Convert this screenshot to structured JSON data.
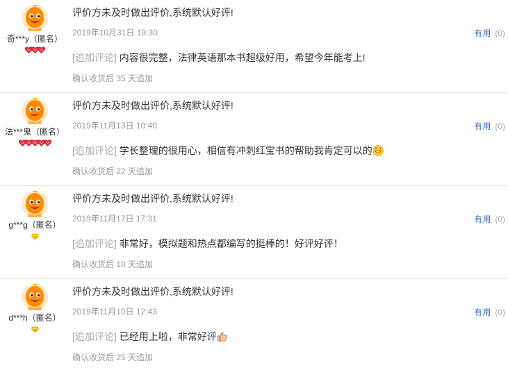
{
  "reviews": [
    {
      "user": "奇***y（匿名）",
      "level_icon": "red-heart-diamond-icon",
      "level_count": 3,
      "content": "评价方未及时做出评价,系统默认好评!",
      "date": "2019年10月31日 19:30",
      "useful_label": "有用",
      "useful_count": "(0)",
      "add_label": "[追加评论]",
      "add_text": "内容很完整，法律英语那本书超级好用，希望今年能考上!",
      "add_emoji": "",
      "confirm": "确认收货后 35 天追加"
    },
    {
      "user": "法***鬼（匿名）",
      "level_icon": "red-heart-diamond-icon",
      "level_count": 5,
      "content": "评价方未及时做出评价,系统默认好评!",
      "date": "2019年11月13日 10:40",
      "useful_label": "有用",
      "useful_count": "(0)",
      "add_label": "[追加评论]",
      "add_text": "学长整理的很用心，相信有冲刺红宝书的帮助我肯定可以的",
      "add_emoji": "grinning-emoji-icon",
      "confirm": "确认收货后 22 天追加"
    },
    {
      "user": "g***g（匿名）",
      "level_icon": "yellow-diamond-icon",
      "level_count": 1,
      "content": "评价方未及时做出评价,系统默认好评!",
      "date": "2019年11月17日 17:31",
      "useful_label": "有用",
      "useful_count": "(0)",
      "add_label": "[追加评论]",
      "add_text": "非常好，模拟题和热点都编写的挺棒的！好评好评！",
      "add_emoji": "",
      "confirm": "确认收货后 18 天追加"
    },
    {
      "user": "d***h（匿名）",
      "level_icon": "yellow-diamond-icon",
      "level_count": 1,
      "content": "评价方未及时做出评价,系统默认好评!",
      "date": "2019年11月10日 12:43",
      "useful_label": "有用",
      "useful_count": "(0)",
      "add_label": "[追加评论]",
      "add_text": "已经用上啦，非常好评",
      "add_emoji": "thumbs-up-emoji-icon",
      "confirm": "确认收货后 25 天追加"
    }
  ],
  "colors": {
    "useful_link": "#3c6eb4",
    "muted_text": "#999999",
    "avatar_orange": "#ff8a00",
    "heart_red": "#e8303c",
    "diamond_yellow": "#f5b800"
  }
}
